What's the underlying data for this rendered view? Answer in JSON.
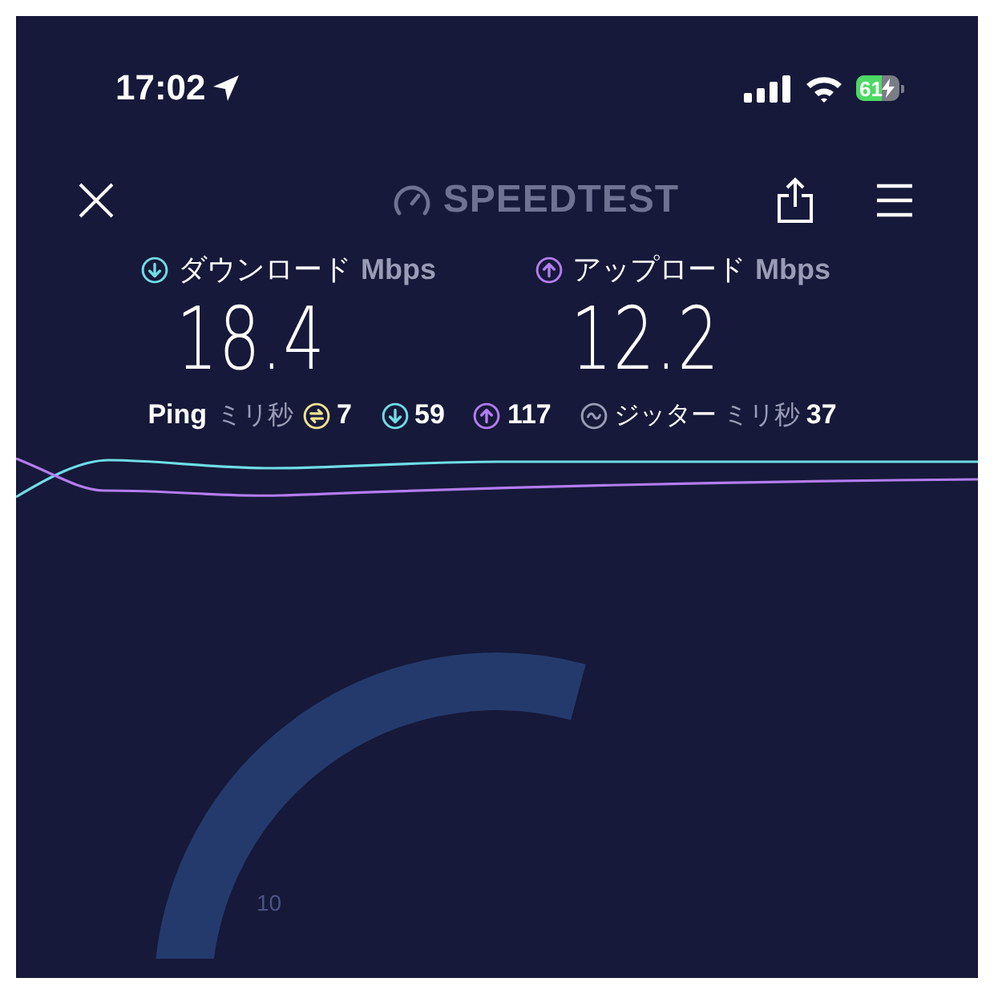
{
  "status_bar": {
    "time": "17:02",
    "battery": "61",
    "charging": true
  },
  "nav": {
    "logo": "SPEEDTEST"
  },
  "results": [
    {
      "kind": "download",
      "label": "ダウンロード",
      "unit": "Mbps",
      "value": "18.4",
      "color": "#6fdde6"
    },
    {
      "kind": "upload",
      "label": "アップロード",
      "unit": "Mbps",
      "value": "12.2",
      "color": "#b37cf0"
    }
  ],
  "ping": {
    "label": "Ping",
    "unit": "ミリ秒",
    "items": [
      {
        "kind": "idle",
        "value": "7",
        "color": "#efe28f"
      },
      {
        "kind": "download",
        "value": "59",
        "color": "#6fdde6"
      },
      {
        "kind": "upload",
        "value": "117",
        "color": "#b37cf0"
      }
    ]
  },
  "jitter": {
    "label": "ジッター",
    "unit": "ミリ秒",
    "value": "37"
  },
  "gauge": {
    "tick_label": "10"
  }
}
